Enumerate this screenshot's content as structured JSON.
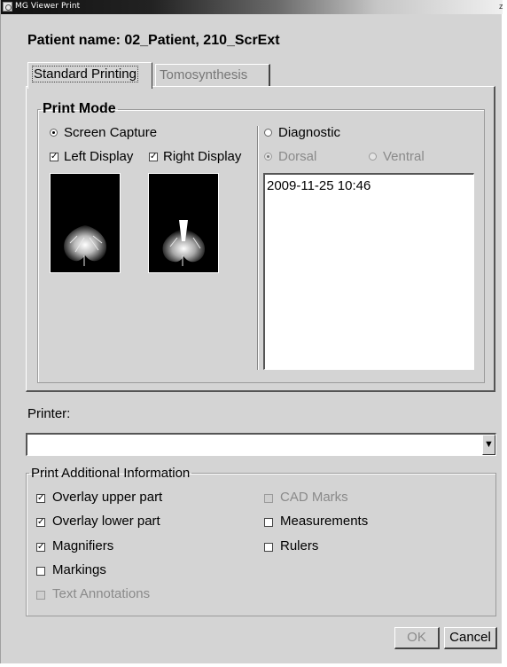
{
  "window": {
    "title": "MG Viewer Print",
    "corner_glyph": "z"
  },
  "patient": {
    "label": "Patient name: 02_Patient, 210_ScrExt"
  },
  "tabs": [
    {
      "label": "Standard Printing",
      "selected": true
    },
    {
      "label": "Tomosynthesis",
      "selected": false
    }
  ],
  "print_mode": {
    "legend": "Print Mode",
    "screen_capture": {
      "label": "Screen Capture",
      "selected": true
    },
    "left_display": {
      "label": "Left Display",
      "checked": true
    },
    "right_display": {
      "label": "Right Display",
      "checked": true
    },
    "diagnostic": {
      "label": "Diagnostic",
      "selected": false
    },
    "dorsal": {
      "label": "Dorsal",
      "selected": true,
      "enabled": false
    },
    "ventral": {
      "label": "Ventral",
      "selected": false,
      "enabled": false
    },
    "image_list": [
      "2009-11-25 10:46"
    ]
  },
  "printer": {
    "label": "Printer:",
    "value": "",
    "arrow": "▼"
  },
  "additional_info": {
    "legend": "Print Additional Information",
    "overlay_upper": {
      "label": "Overlay upper part",
      "checked": true
    },
    "overlay_lower": {
      "label": "Overlay lower part",
      "checked": true
    },
    "magnifiers": {
      "label": "Magnifiers",
      "checked": true
    },
    "markings": {
      "label": "Markings",
      "checked": false
    },
    "text_annotations": {
      "label": "Text Annotations",
      "checked": false,
      "enabled": false
    },
    "cad_marks": {
      "label": "CAD Marks",
      "checked": false,
      "enabled": false
    },
    "measurements": {
      "label": "Measurements",
      "checked": false
    },
    "rulers": {
      "label": "Rulers",
      "checked": false
    }
  },
  "buttons": {
    "ok": "OK",
    "cancel": "Cancel",
    "ok_enabled": false
  },
  "check_glyph": "✓"
}
